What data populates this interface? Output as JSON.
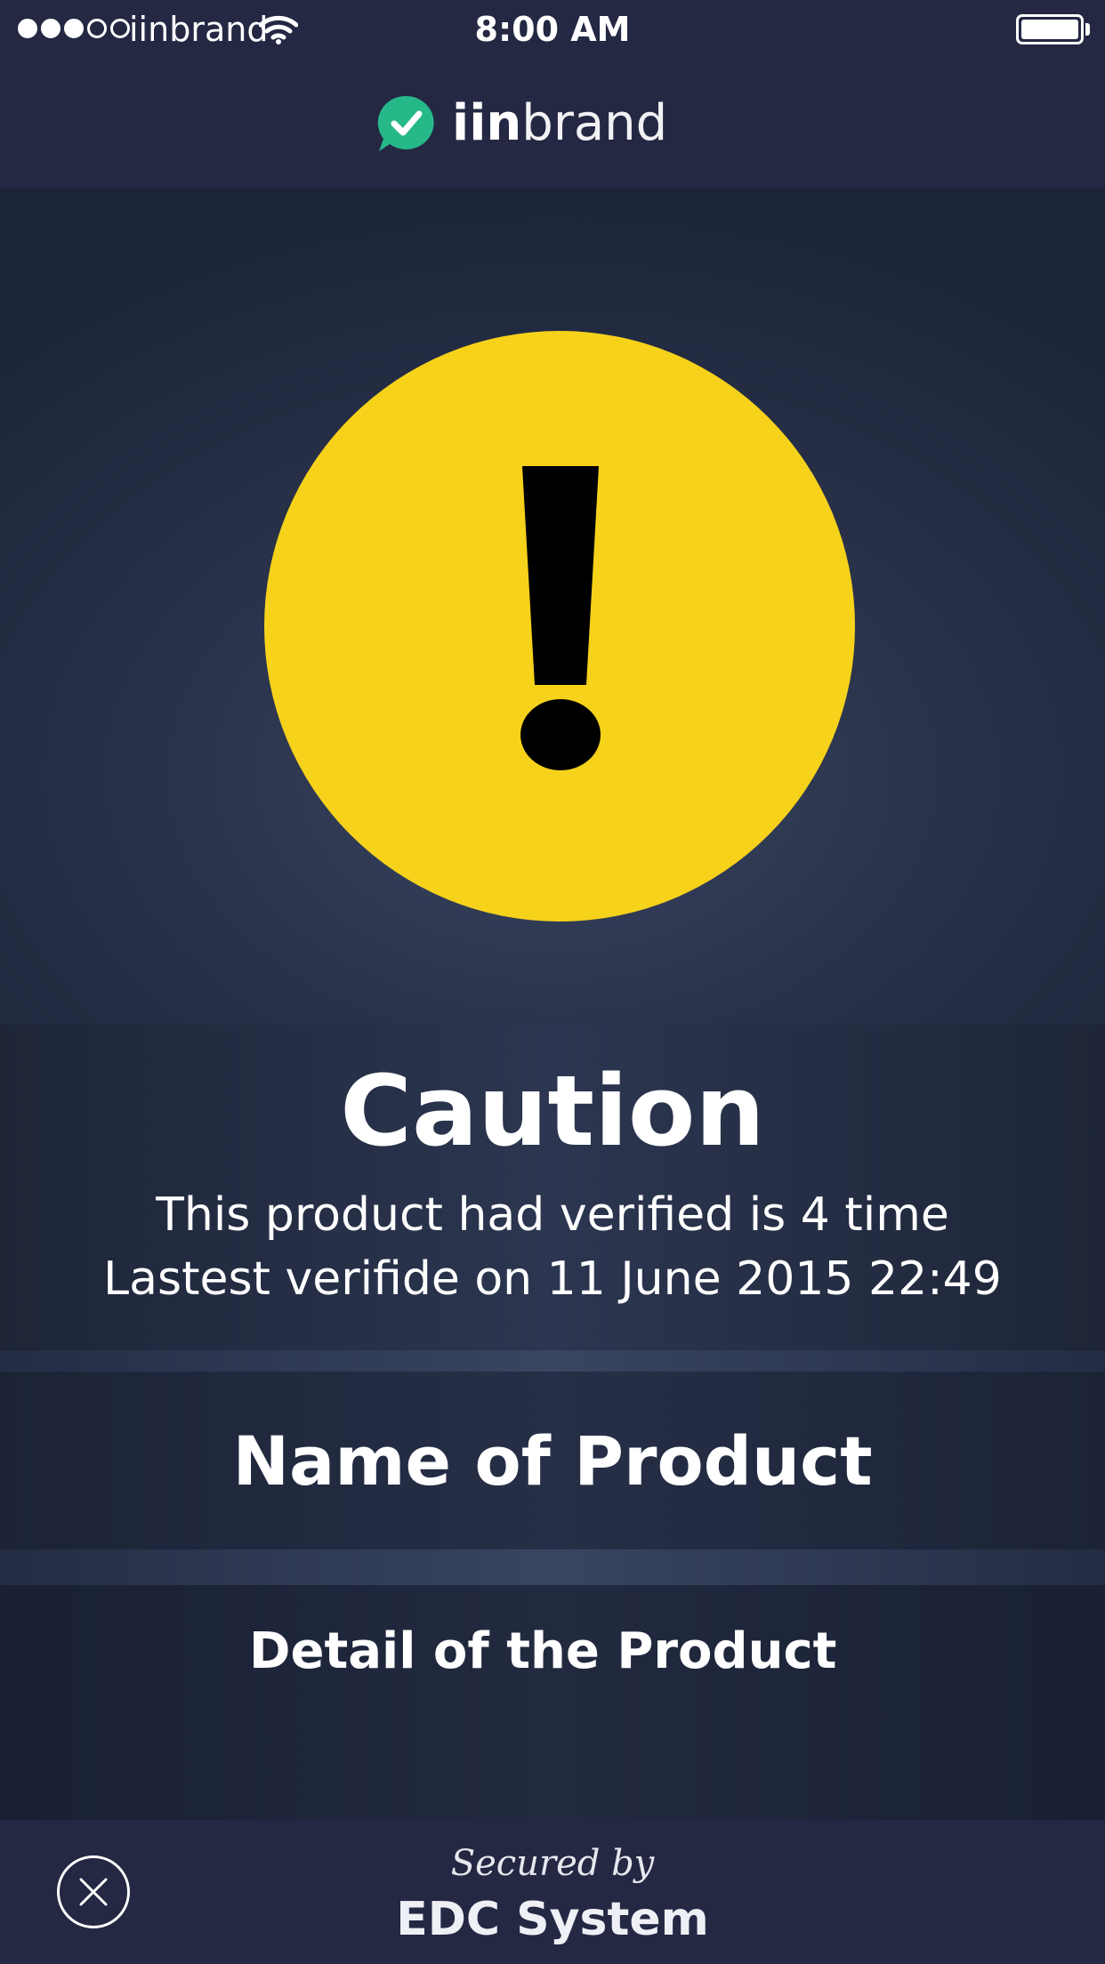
{
  "status_bar": {
    "carrier": "iinbrand",
    "time": "8:00 AM",
    "signal_bars_filled": 3,
    "signal_bars_total": 5,
    "wifi_icon": "wifi-icon",
    "battery_level": 1.0
  },
  "nav": {
    "brand_prefix": "iin",
    "brand_suffix": "brand",
    "brand_icon": "check-speech-bubble-icon",
    "brand_icon_color": "#27b889"
  },
  "result": {
    "icon": "exclamation-warning-icon",
    "icon_color": "#f6d21b",
    "title": "Caution",
    "line1": "This product had verified is 4 time",
    "line2": "Lastest verifide on 11 June 2015 22:49"
  },
  "product": {
    "name": "Name of Product",
    "detail": "Detail of the Product"
  },
  "footer": {
    "close_icon": "close-circle-icon",
    "secured_by": "Secured by",
    "system_name": "EDC System"
  }
}
